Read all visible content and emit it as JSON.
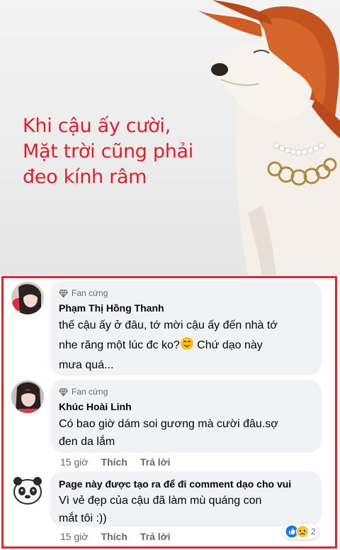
{
  "hero": {
    "caption_lines": [
      "Khi cậu ấy cười,",
      "Mặt trời cũng phải",
      "đeo kính râm"
    ]
  },
  "comments": [
    {
      "badge": "Fan cứng",
      "author": "Phạm Thị Hồng Thanh",
      "lines": [
        "thế cậu ấy ở đâu, tớ mời cậu ấy đến nhà tớ",
        "nhe răng một lúc đc ko?",
        " Chứ dạo này",
        "mưa quá..."
      ]
    },
    {
      "badge": "Fan cứng",
      "author": "Khúc Hoài Linh",
      "lines": [
        "Có bao giờ dám soi gương mà cười đâu.sợ",
        "đen da lắm"
      ],
      "time": "15 giờ",
      "like": "Thích",
      "reply": "Trả lời"
    },
    {
      "author": "Page này được tạo ra để đi comment dạo cho vui",
      "lines": [
        "Vì vẻ đẹp của cậu đã làm mù quáng con",
        "mắt tôi :))"
      ],
      "time": "15 giờ",
      "like": "Thích",
      "reply": "Trả lời",
      "reaction_count": "2"
    }
  ],
  "colors": {
    "caption": "#e01f26",
    "border": "#e3252b",
    "bubble": "#f0f2f5"
  },
  "icons": [
    "diamond-icon",
    "smiling-emoji-icon",
    "like-reaction-icon",
    "sad-reaction-icon"
  ]
}
